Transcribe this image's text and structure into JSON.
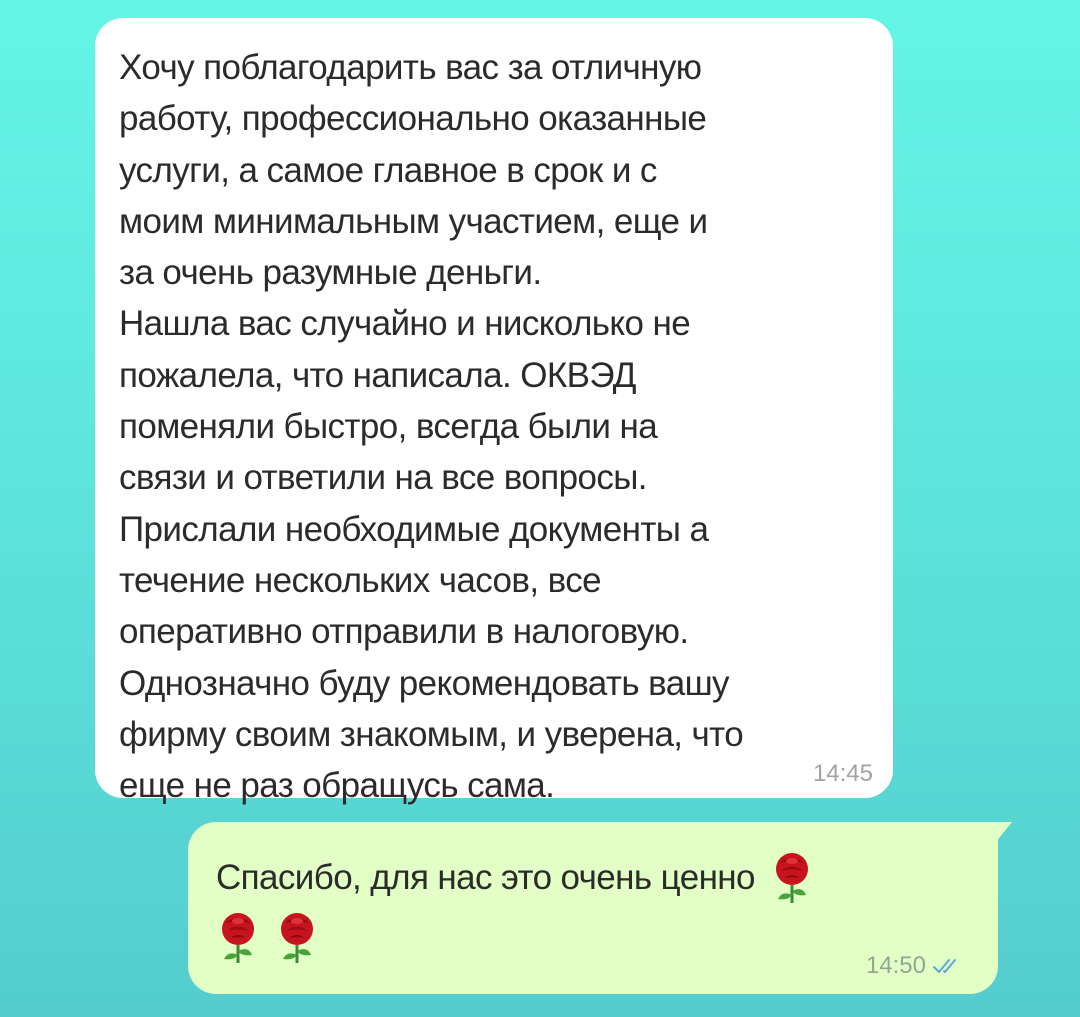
{
  "incoming_message": {
    "lines": [
      "Хочу поблагодарить вас за отличную",
      "работу, профессионально оказанные",
      "услуги, а самое главное в срок и с",
      "моим минимальным участием, еще и",
      "за очень разумные деньги.",
      "Нашла вас случайно и нисколько не",
      "пожалела, что написала. ОКВЭД",
      "поменяли быстро, всегда были на",
      "связи и ответили на все вопросы.",
      "Прислали необходимые документы а",
      "течение нескольких часов, все",
      "оперативно отправили в налоговую.",
      "Однозначно буду рекомендовать вашу",
      "фирму своим знакомым, и уверена, что",
      "еще не раз обращусь сама."
    ],
    "time": "14:45"
  },
  "outgoing_message": {
    "text": "Спасибо, для нас это очень ценно",
    "emoji": [
      "rose-emoji",
      "rose-emoji",
      "rose-emoji"
    ],
    "time": "14:50",
    "status_icon": "double-check-icon",
    "status": "read"
  },
  "colors": {
    "background_top": "#63f5e6",
    "background_bottom": "#54cccd",
    "incoming_bubble": "#ffffff",
    "outgoing_bubble": "#e2ffc6",
    "read_ticks": "#5aa7d8"
  }
}
